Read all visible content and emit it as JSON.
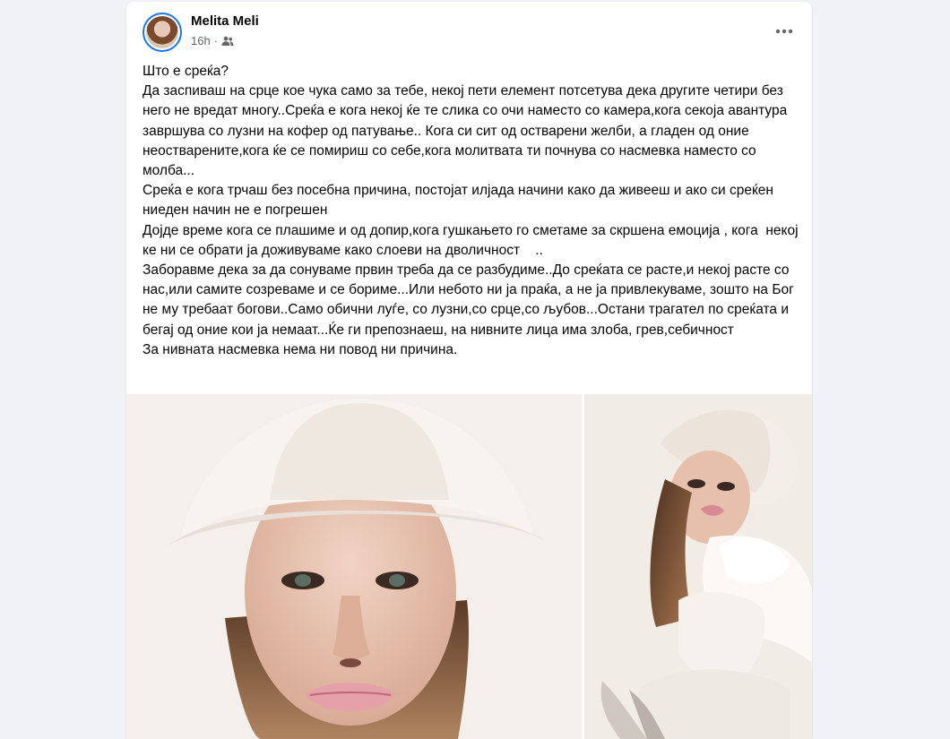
{
  "post": {
    "author": "Melita Meli",
    "time": "16h",
    "audience_icon": "friends-icon",
    "more_icon": "more-horizontal-icon",
    "text": "Што е среќа?\nДа заспиваш на срце кое чука само за тебе, некој пети елемент потсетува дека другите четири без него не вредат многу..Среќа е кога некој ќе те слика со очи наместо со камера,кога секоја авантура завршува со лузни на кофер од патување.. Кога си сит од остварени желби, а гладен од оние неостварените,кога ќе се помириш со себе,кога молитвата ти почнува со насмевка наместо со молба...\nСреќа е кога трчаш без посебна причина, постојат илјада начини како да живееш и ако си среќен ниеден начин не е погрешен\nДојде време кога се плашиме и од допир,кога гушкањето го сметаме за скршена емоција , кога  некој ке ни се обрати ја доживуваме како слоеви на дволичност    ..\nЗаборавме дека за да сонуваме првин треба да се разбудиме..До среќата се расте,и некој расте со нас,или самите созреваме и се бориме...Или небото ни ја праќа, а не ја привлекуваме, зошто на Бог не му требаат богови..Само обични луѓе, со лузни,со срце,со љубов...Остани трагател по среќата и бегај од оние кои ја немаат...Ќе ги препознаеш, на нивните лица има злоба, грев,себичност\nЗа нивната насмевка нема ни повод ни причина."
  },
  "colors": {
    "background": "#f0f2f5",
    "card": "#ffffff",
    "text": "#050505",
    "secondary_text": "#65676b",
    "avatar_ring": "#1877f2"
  },
  "photos": [
    {
      "icon": "photo-woman-white-hat-closeup"
    },
    {
      "icon": "photo-woman-white-hat-fur"
    }
  ]
}
